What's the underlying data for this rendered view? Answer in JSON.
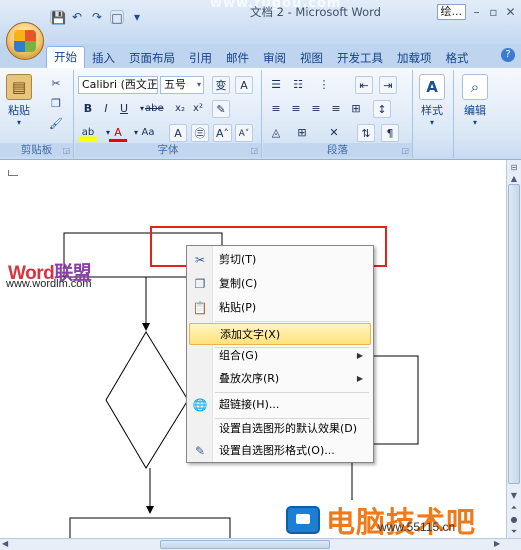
{
  "window": {
    "title": "文档 2 - Microsoft Word",
    "watermark_top": "www.rugou.com",
    "ribbon_min_label": "绘...",
    "qat": {
      "save_icon": "💾",
      "undo_icon": "↶",
      "redo_icon": "↷",
      "customize_icon": "▾"
    }
  },
  "tabs": [
    {
      "label": "开始",
      "active": true
    },
    {
      "label": "插入"
    },
    {
      "label": "页面布局"
    },
    {
      "label": "引用"
    },
    {
      "label": "邮件"
    },
    {
      "label": "审阅"
    },
    {
      "label": "视图"
    },
    {
      "label": "开发工具"
    },
    {
      "label": "加载项"
    },
    {
      "label": "格式"
    }
  ],
  "ribbon": {
    "clipboard": {
      "paste_label": "粘贴",
      "group_label": "剪贴板"
    },
    "font": {
      "font_name": "Calibri (西文正",
      "font_size": "五号",
      "group_label": "字体"
    },
    "paragraph": {
      "group_label": "段落"
    },
    "styles": {
      "label": "样式"
    },
    "editing": {
      "label": "编辑"
    }
  },
  "document": {
    "watermark_word": "Word",
    "watermark_lm": "联盟",
    "watermark_url": "www.wordlm.com",
    "watermark_bottom": "电脑技术吧",
    "watermark_site": "www.55115.cn"
  },
  "context_menu": {
    "items": [
      {
        "label": "剪切(T)",
        "icon": "scissors-icon",
        "glyph": "✂",
        "highlighted": false
      },
      {
        "label": "复制(C)",
        "icon": "copy-icon",
        "glyph": "❐",
        "highlighted": false
      },
      {
        "label": "粘贴(P)",
        "icon": "paste-icon",
        "glyph": "📋",
        "highlighted": false
      },
      {
        "label": "添加文字(X)",
        "icon": "",
        "glyph": "",
        "highlighted": true
      },
      {
        "label": "组合(G)",
        "icon": "",
        "glyph": "",
        "submenu": true
      },
      {
        "label": "叠放次序(R)",
        "icon": "",
        "glyph": "",
        "submenu": true
      },
      {
        "label": "超链接(H)...",
        "icon": "hyperlink-icon",
        "glyph": "🌐"
      },
      {
        "label": "设置自选图形的默认效果(D)",
        "icon": "",
        "glyph": ""
      },
      {
        "label": "设置自选图形格式(O)...",
        "icon": "format-shape-icon",
        "glyph": "✎"
      }
    ]
  },
  "colors": {
    "ribbon_text": "#15428b",
    "highlight": "#ffe27a",
    "red_box": "#e0241a",
    "accent_orange": "#f07a1a"
  }
}
